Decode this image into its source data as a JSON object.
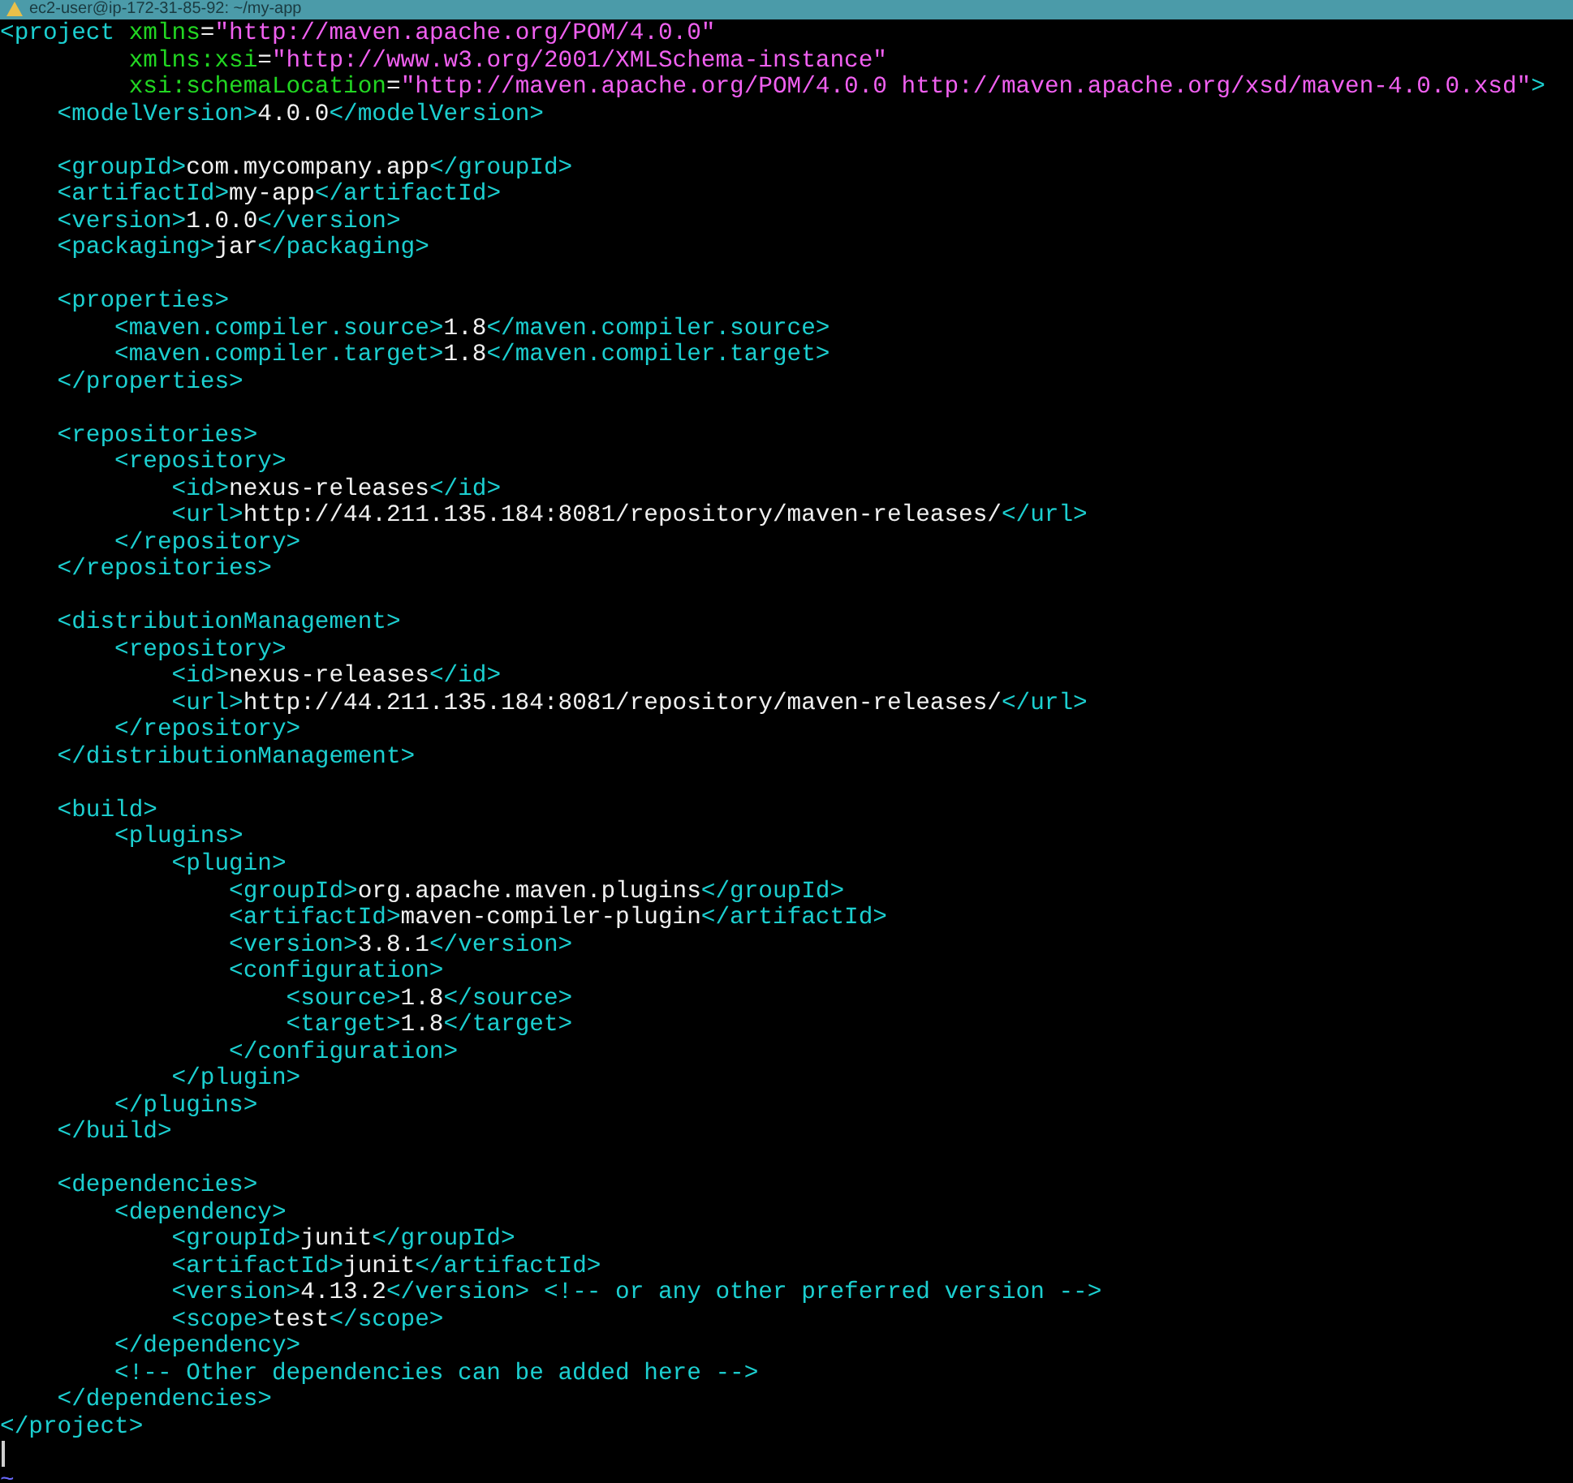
{
  "window": {
    "title": "ec2-user@ip-172-31-85-92: ~/my-app"
  },
  "lines": [
    {
      "kind": "code",
      "segments": [
        {
          "kind": "tag",
          "text": "<project"
        },
        {
          "kind": "attr",
          "text": " xmlns"
        },
        {
          "kind": "text",
          "text": "="
        },
        {
          "kind": "string",
          "text": "\"http://maven.apache.org/POM/4.0.0\""
        }
      ]
    },
    {
      "kind": "code",
      "segments": [
        {
          "kind": "attr",
          "text": "         xmlns:xsi"
        },
        {
          "kind": "text",
          "text": "="
        },
        {
          "kind": "string",
          "text": "\"http://www.w3.org/2001/XMLSchema-instance\""
        }
      ]
    },
    {
      "kind": "code",
      "segments": [
        {
          "kind": "attr",
          "text": "         xsi:schemaLocation"
        },
        {
          "kind": "text",
          "text": "="
        },
        {
          "kind": "string",
          "text": "\"http://maven.apache.org/POM/4.0.0 http://maven.apache.org/xsd/maven-4.0.0.xsd\""
        },
        {
          "kind": "tag",
          "text": ">"
        }
      ]
    },
    {
      "kind": "code",
      "segments": [
        {
          "kind": "tag",
          "text": "    <modelVersion>"
        },
        {
          "kind": "text",
          "text": "4.0.0"
        },
        {
          "kind": "tag",
          "text": "</modelVersion>"
        }
      ]
    },
    {
      "kind": "blank"
    },
    {
      "kind": "code",
      "segments": [
        {
          "kind": "tag",
          "text": "    <groupId>"
        },
        {
          "kind": "text",
          "text": "com.mycompany.app"
        },
        {
          "kind": "tag",
          "text": "</groupId>"
        }
      ]
    },
    {
      "kind": "code",
      "segments": [
        {
          "kind": "tag",
          "text": "    <artifactId>"
        },
        {
          "kind": "text",
          "text": "my-app"
        },
        {
          "kind": "tag",
          "text": "</artifactId>"
        }
      ]
    },
    {
      "kind": "code",
      "segments": [
        {
          "kind": "tag",
          "text": "    <version>"
        },
        {
          "kind": "text",
          "text": "1.0.0"
        },
        {
          "kind": "tag",
          "text": "</version>"
        }
      ]
    },
    {
      "kind": "code",
      "segments": [
        {
          "kind": "tag",
          "text": "    <packaging>"
        },
        {
          "kind": "text",
          "text": "jar"
        },
        {
          "kind": "tag",
          "text": "</packaging>"
        }
      ]
    },
    {
      "kind": "blank"
    },
    {
      "kind": "code",
      "segments": [
        {
          "kind": "tag",
          "text": "    <properties>"
        }
      ]
    },
    {
      "kind": "code",
      "segments": [
        {
          "kind": "tag",
          "text": "        <maven.compiler.source>"
        },
        {
          "kind": "text",
          "text": "1.8"
        },
        {
          "kind": "tag",
          "text": "</maven.compiler.source>"
        }
      ]
    },
    {
      "kind": "code",
      "segments": [
        {
          "kind": "tag",
          "text": "        <maven.compiler.target>"
        },
        {
          "kind": "text",
          "text": "1.8"
        },
        {
          "kind": "tag",
          "text": "</maven.compiler.target>"
        }
      ]
    },
    {
      "kind": "code",
      "segments": [
        {
          "kind": "tag",
          "text": "    </properties>"
        }
      ]
    },
    {
      "kind": "blank"
    },
    {
      "kind": "code",
      "segments": [
        {
          "kind": "tag",
          "text": "    <repositories>"
        }
      ]
    },
    {
      "kind": "code",
      "segments": [
        {
          "kind": "tag",
          "text": "        <repository>"
        }
      ]
    },
    {
      "kind": "code",
      "segments": [
        {
          "kind": "tag",
          "text": "            <id>"
        },
        {
          "kind": "text",
          "text": "nexus-releases"
        },
        {
          "kind": "tag",
          "text": "</id>"
        }
      ]
    },
    {
      "kind": "code",
      "segments": [
        {
          "kind": "tag",
          "text": "            <url>"
        },
        {
          "kind": "text",
          "text": "http://44.211.135.184:8081/repository/maven-releases/"
        },
        {
          "kind": "tag",
          "text": "</url>"
        }
      ]
    },
    {
      "kind": "code",
      "segments": [
        {
          "kind": "tag",
          "text": "        </repository>"
        }
      ]
    },
    {
      "kind": "code",
      "segments": [
        {
          "kind": "tag",
          "text": "    </repositories>"
        }
      ]
    },
    {
      "kind": "blank"
    },
    {
      "kind": "code",
      "segments": [
        {
          "kind": "tag",
          "text": "    <distributionManagement>"
        }
      ]
    },
    {
      "kind": "code",
      "segments": [
        {
          "kind": "tag",
          "text": "        <repository>"
        }
      ]
    },
    {
      "kind": "code",
      "segments": [
        {
          "kind": "tag",
          "text": "            <id>"
        },
        {
          "kind": "text",
          "text": "nexus-releases"
        },
        {
          "kind": "tag",
          "text": "</id>"
        }
      ]
    },
    {
      "kind": "code",
      "segments": [
        {
          "kind": "tag",
          "text": "            <url>"
        },
        {
          "kind": "text",
          "text": "http://44.211.135.184:8081/repository/maven-releases/"
        },
        {
          "kind": "tag",
          "text": "</url>"
        }
      ]
    },
    {
      "kind": "code",
      "segments": [
        {
          "kind": "tag",
          "text": "        </repository>"
        }
      ]
    },
    {
      "kind": "code",
      "segments": [
        {
          "kind": "tag",
          "text": "    </distributionManagement>"
        }
      ]
    },
    {
      "kind": "blank"
    },
    {
      "kind": "code",
      "segments": [
        {
          "kind": "tag",
          "text": "    <build>"
        }
      ]
    },
    {
      "kind": "code",
      "segments": [
        {
          "kind": "tag",
          "text": "        <plugins>"
        }
      ]
    },
    {
      "kind": "code",
      "segments": [
        {
          "kind": "tag",
          "text": "            <plugin>"
        }
      ]
    },
    {
      "kind": "code",
      "segments": [
        {
          "kind": "tag",
          "text": "                <groupId>"
        },
        {
          "kind": "text",
          "text": "org.apache.maven.plugins"
        },
        {
          "kind": "tag",
          "text": "</groupId>"
        }
      ]
    },
    {
      "kind": "code",
      "segments": [
        {
          "kind": "tag",
          "text": "                <artifactId>"
        },
        {
          "kind": "text",
          "text": "maven-compiler-plugin"
        },
        {
          "kind": "tag",
          "text": "</artifactId>"
        }
      ]
    },
    {
      "kind": "code",
      "segments": [
        {
          "kind": "tag",
          "text": "                <version>"
        },
        {
          "kind": "text",
          "text": "3.8.1"
        },
        {
          "kind": "tag",
          "text": "</version>"
        }
      ]
    },
    {
      "kind": "code",
      "segments": [
        {
          "kind": "tag",
          "text": "                <configuration>"
        }
      ]
    },
    {
      "kind": "code",
      "segments": [
        {
          "kind": "tag",
          "text": "                    <source>"
        },
        {
          "kind": "text",
          "text": "1.8"
        },
        {
          "kind": "tag",
          "text": "</source>"
        }
      ]
    },
    {
      "kind": "code",
      "segments": [
        {
          "kind": "tag",
          "text": "                    <target>"
        },
        {
          "kind": "text",
          "text": "1.8"
        },
        {
          "kind": "tag",
          "text": "</target>"
        }
      ]
    },
    {
      "kind": "code",
      "segments": [
        {
          "kind": "tag",
          "text": "                </configuration>"
        }
      ]
    },
    {
      "kind": "code",
      "segments": [
        {
          "kind": "tag",
          "text": "            </plugin>"
        }
      ]
    },
    {
      "kind": "code",
      "segments": [
        {
          "kind": "tag",
          "text": "        </plugins>"
        }
      ]
    },
    {
      "kind": "code",
      "segments": [
        {
          "kind": "tag",
          "text": "    </build>"
        }
      ]
    },
    {
      "kind": "blank"
    },
    {
      "kind": "code",
      "segments": [
        {
          "kind": "tag",
          "text": "    <dependencies>"
        }
      ]
    },
    {
      "kind": "code",
      "segments": [
        {
          "kind": "tag",
          "text": "        <dependency>"
        }
      ]
    },
    {
      "kind": "code",
      "segments": [
        {
          "kind": "tag",
          "text": "            <groupId>"
        },
        {
          "kind": "text",
          "text": "junit"
        },
        {
          "kind": "tag",
          "text": "</groupId>"
        }
      ]
    },
    {
      "kind": "code",
      "segments": [
        {
          "kind": "tag",
          "text": "            <artifactId>"
        },
        {
          "kind": "text",
          "text": "junit"
        },
        {
          "kind": "tag",
          "text": "</artifactId>"
        }
      ]
    },
    {
      "kind": "code",
      "segments": [
        {
          "kind": "tag",
          "text": "            <version>"
        },
        {
          "kind": "text",
          "text": "4.13.2"
        },
        {
          "kind": "tag",
          "text": "</version>"
        },
        {
          "kind": "comment",
          "text": " <!-- or any other preferred version -->"
        }
      ]
    },
    {
      "kind": "code",
      "segments": [
        {
          "kind": "tag",
          "text": "            <scope>"
        },
        {
          "kind": "text",
          "text": "test"
        },
        {
          "kind": "tag",
          "text": "</scope>"
        }
      ]
    },
    {
      "kind": "code",
      "segments": [
        {
          "kind": "tag",
          "text": "        </dependency>"
        }
      ]
    },
    {
      "kind": "code",
      "segments": [
        {
          "kind": "comment",
          "text": "        <!-- Other dependencies can be added here -->"
        }
      ]
    },
    {
      "kind": "code",
      "segments": [
        {
          "kind": "tag",
          "text": "    </dependencies>"
        }
      ]
    },
    {
      "kind": "code",
      "segments": [
        {
          "kind": "tag",
          "text": "</project>"
        }
      ]
    },
    {
      "kind": "cursor"
    },
    {
      "kind": "tilde",
      "text": "~"
    }
  ]
}
